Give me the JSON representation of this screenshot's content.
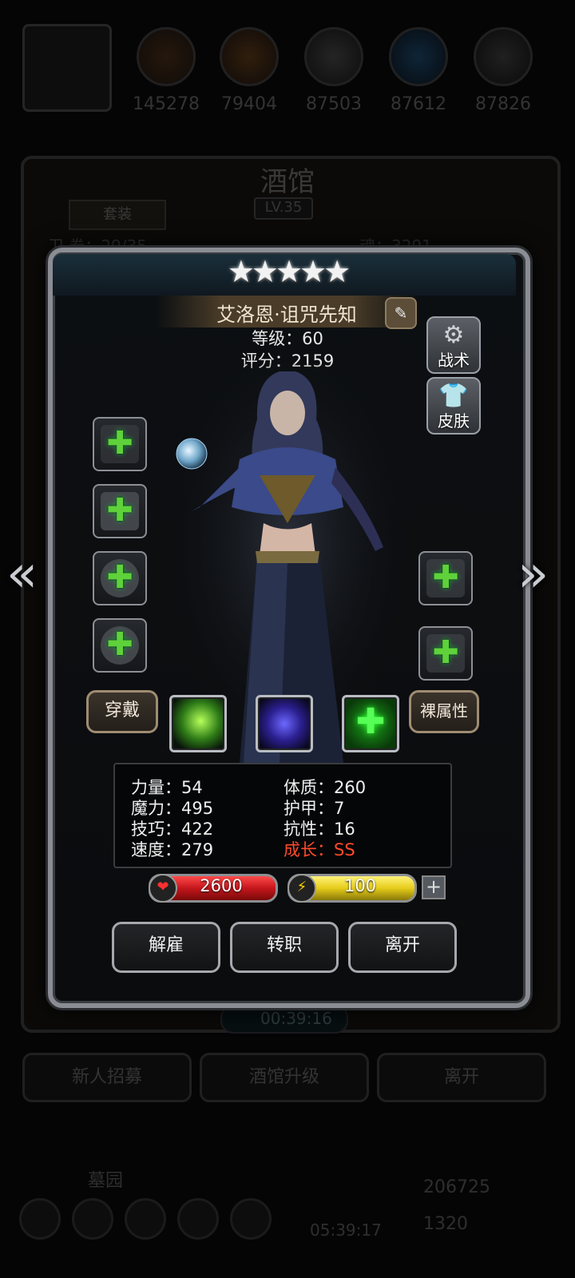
{
  "resources": {
    "values": [
      "145278",
      "79404",
      "87503",
      "87612",
      "87826"
    ],
    "icons": [
      "food-icon",
      "wood-icon",
      "stone-icon",
      "crystal-icon",
      "metal-icon"
    ]
  },
  "tavern": {
    "title": "酒馆",
    "level": "LV.35",
    "suit_tab": "套装",
    "left_text": "卫  卷：29/35",
    "right_text": "魂：3291"
  },
  "hero": {
    "stars": "★★★★★",
    "name": "艾洛恩·诅咒先知",
    "level": "等级：60",
    "score": "评分：2159",
    "tactics_label": "战术",
    "skin_label": "皮肤",
    "wear_label": "穿戴",
    "base_attr_label": "裸属性"
  },
  "stats": {
    "strength": "力量：54",
    "magic": "魔力：495",
    "skill": "技巧：422",
    "speed": "速度：279",
    "constitution": "体质：260",
    "armor": "护甲：7",
    "resistance": "抗性：16",
    "growth": "成长：SS"
  },
  "bars": {
    "hp": "2600",
    "energy": "100"
  },
  "actions": {
    "dismiss": "解雇",
    "transfer": "转职",
    "leave": "离开"
  },
  "timer": "00:39:16",
  "bottom": {
    "recruit": "新人招募",
    "upgrade": "酒馆升级",
    "leave": "离开",
    "area_label": "墓园",
    "small_timer": "05:39:17",
    "coins": "206725",
    "gems": "1320"
  },
  "colors": {
    "hp_bar": "#c4161c",
    "energy_bar": "#e6cc1a",
    "growth_text": "#ff4a2a",
    "plus_green": "#5fd13a"
  }
}
